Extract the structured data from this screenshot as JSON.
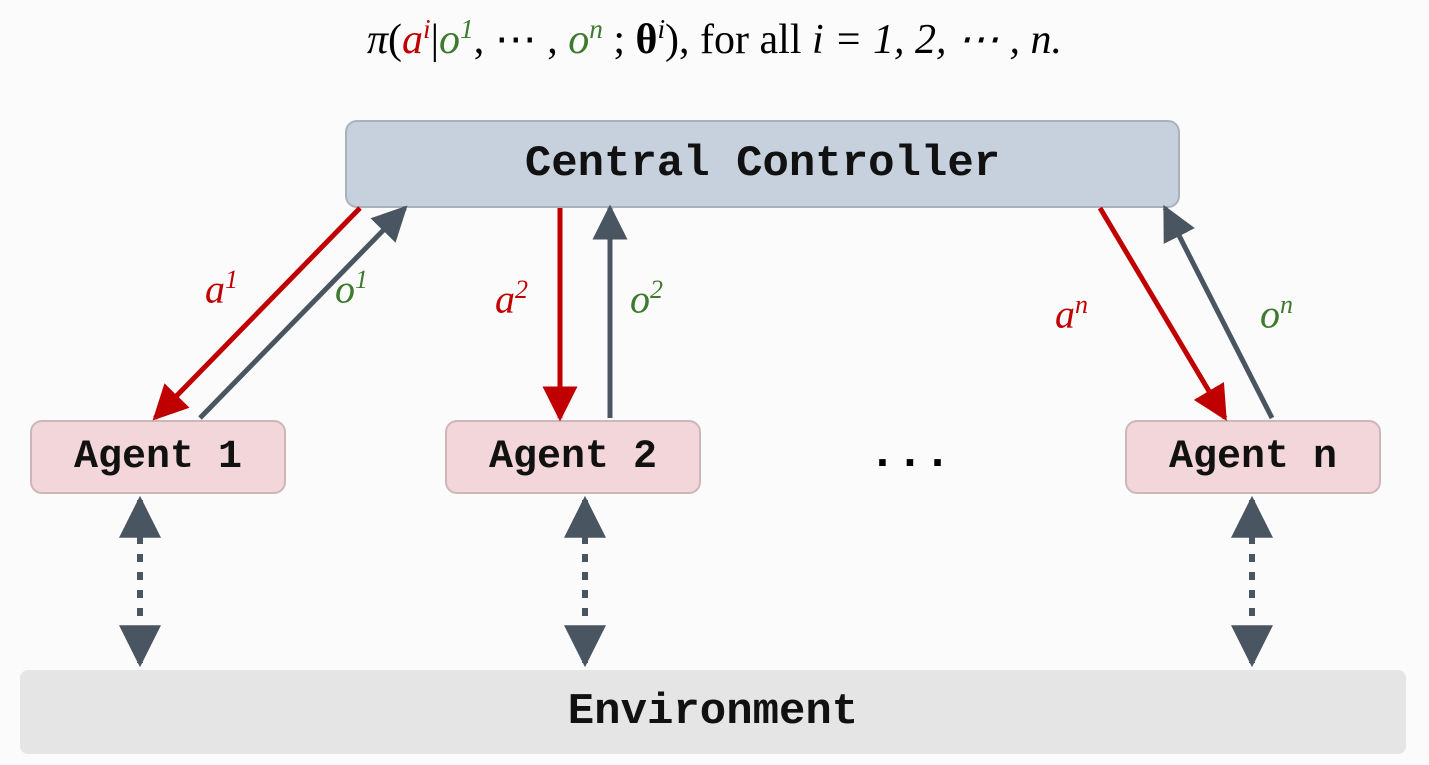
{
  "formula": {
    "pi": "π",
    "lparen": "(",
    "a": "a",
    "sup_i": "i",
    "bar": "|",
    "o": "o",
    "sup_1": "1",
    "comma_ell": ", ⋯ , ",
    "sup_n": "n",
    "sep": " ; ",
    "theta": "θ",
    "rparen": ")",
    "tail": ", for all ",
    "i_eq": "i = 1, 2, ⋯ , n."
  },
  "nodes": {
    "controller": "Central Controller",
    "agent1": "Agent 1",
    "agent2": "Agent 2",
    "agentn": "Agent n",
    "ellipsis": "...",
    "environment": "Environment"
  },
  "edges": {
    "a1": {
      "base": "a",
      "sup": "1"
    },
    "o1": {
      "base": "o",
      "sup": "1"
    },
    "a2": {
      "base": "a",
      "sup": "2"
    },
    "o2": {
      "base": "o",
      "sup": "2"
    },
    "an": {
      "base": "a",
      "sup": "n"
    },
    "on": {
      "base": "o",
      "sup": "n"
    }
  },
  "colors": {
    "action": "#c00000",
    "observation": "#3d7a2e",
    "obs_arrow": "#4a5562",
    "controller_bg": "#c7d1de",
    "agent_bg": "#f2d6d9",
    "env_bg": "#e5e5e5"
  }
}
